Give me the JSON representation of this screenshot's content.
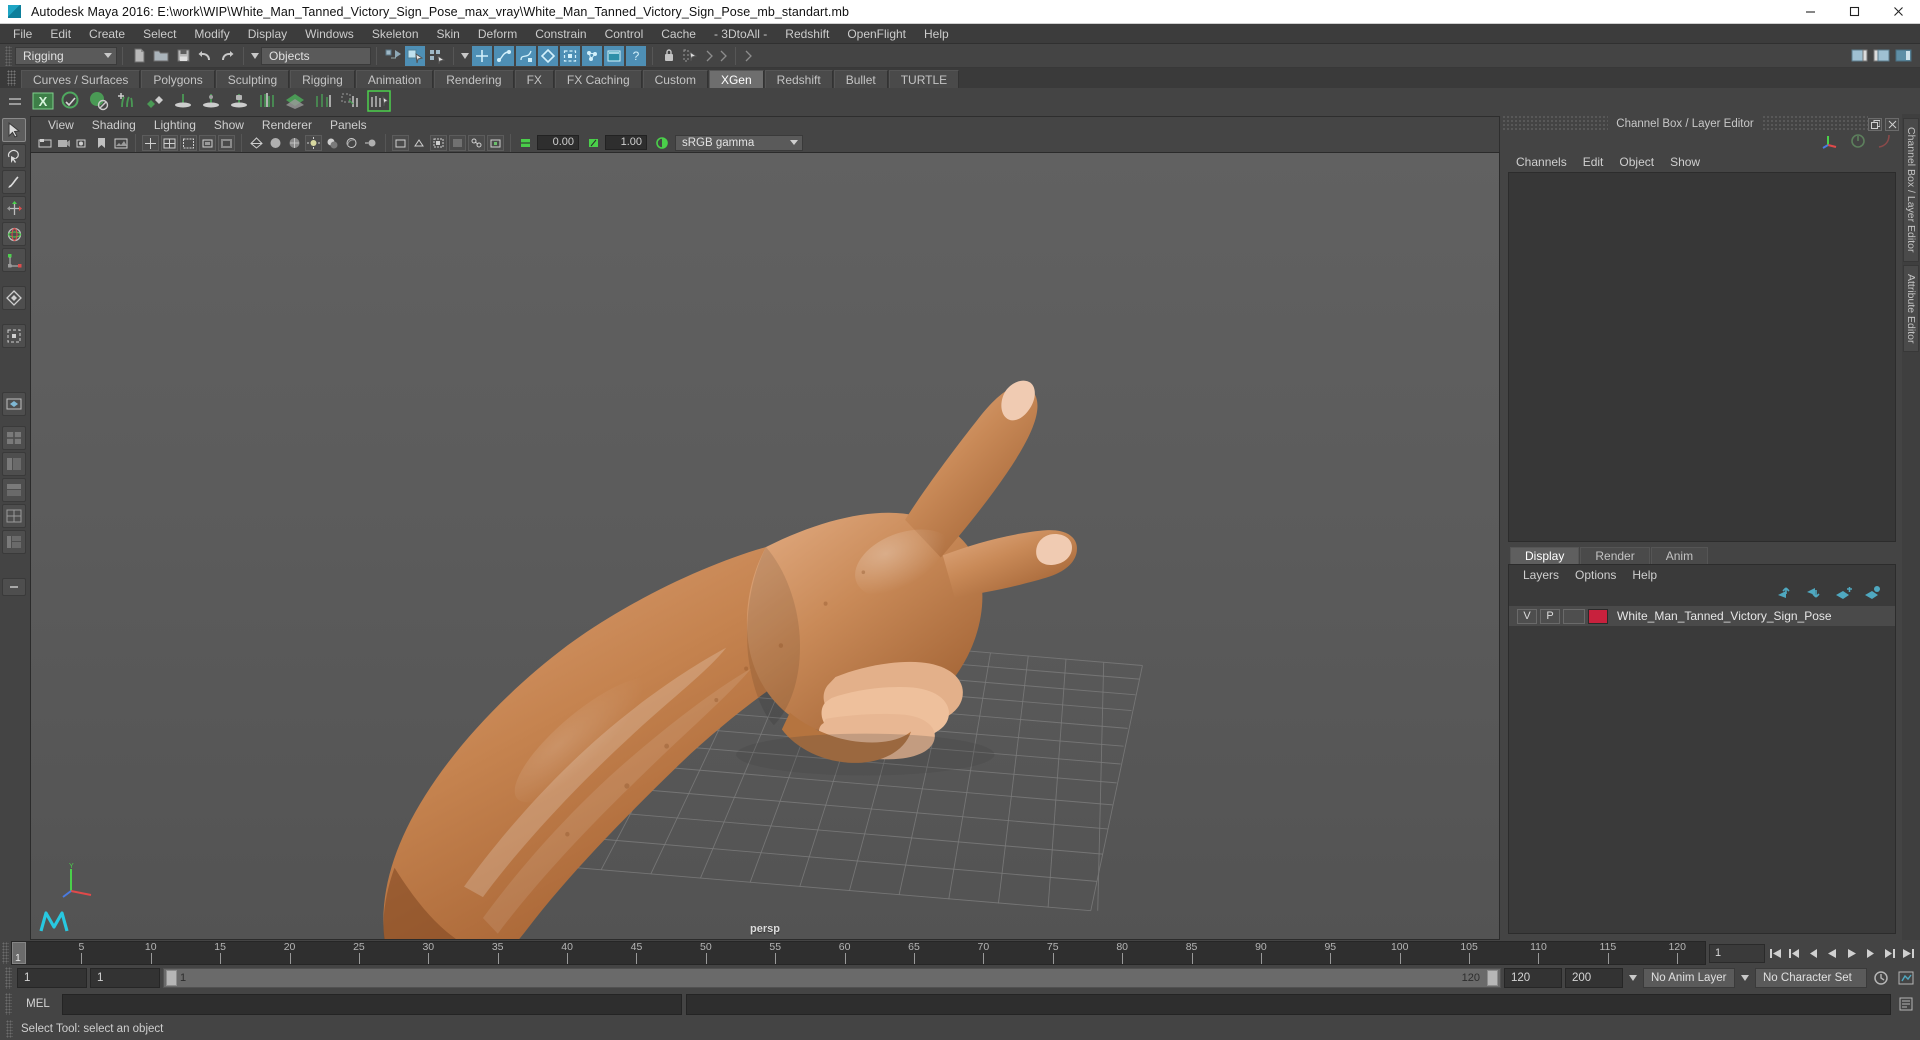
{
  "titlebar": {
    "app_icon": "maya-logo-icon",
    "title": "Autodesk Maya 2016: E:\\work\\WIP\\White_Man_Tanned_Victory_Sign_Pose_max_vray\\White_Man_Tanned_Victory_Sign_Pose_mb_standart.mb",
    "minimize_label": "–",
    "maximize_label": "❐",
    "close_label": "✕"
  },
  "menubar": {
    "items": [
      "File",
      "Edit",
      "Create",
      "Select",
      "Modify",
      "Display",
      "Windows",
      "Skeleton",
      "Skin",
      "Deform",
      "Constrain",
      "Control",
      "Cache",
      "- 3DtoAll -",
      "Redshift",
      "OpenFlight",
      "Help"
    ]
  },
  "statusbar": {
    "mode_menu": "Rigging",
    "selection_mask": "Objects",
    "icons": [
      "new-scene-icon",
      "open-scene-icon",
      "save-scene-icon",
      "undo-icon",
      "redo-icon",
      "select-hierarchy-icon",
      "select-object-icon",
      "select-component-icon",
      "snap-grid-icon",
      "snap-curve-icon",
      "snap-point-icon",
      "snap-view-plane-icon",
      "snap-to-projected-icon",
      "make-live-icon",
      "render-view-icon",
      "help-icon",
      "lock-icon",
      "history-icon",
      "sidebar-toggle-attribute-icon",
      "sidebar-toggle-tool-icon",
      "sidebar-toggle-channel-icon"
    ],
    "right_icons": [
      "show-hide-attribute-editor-icon",
      "show-hide-tool-settings-icon",
      "show-hide-channel-box-icon"
    ]
  },
  "shelf": {
    "tabs": [
      "Curves / Surfaces",
      "Polygons",
      "Sculpting",
      "Rigging",
      "Animation",
      "Rendering",
      "FX",
      "FX Caching",
      "Custom",
      "XGen",
      "Redshift",
      "Bullet",
      "TURTLE"
    ],
    "active_tab": "XGen",
    "icons": [
      "xgen-editor-icon",
      "xgen-sphere-icon",
      "xgen-sphere-filled-icon",
      "xgen-add-guides-icon",
      "xgen-sculpt-guides-icon",
      "xgen-guide-tool-icon",
      "xgen-density-brush-icon",
      "xgen-lock-icon",
      "xgen-comb-icon",
      "xgen-collection-icon",
      "xgen-clump-icon",
      "xgen-noise-icon",
      "xgen-preview-icon"
    ]
  },
  "toolbox": {
    "tools": [
      "select-tool",
      "lasso-select-tool",
      "paint-select-tool",
      "move-tool",
      "rotate-tool",
      "scale-tool",
      "last-tool-used",
      "universal-manipulator",
      "single-perspective-layout",
      "four-view-layout",
      "persp-outliner-layout",
      "persp-graph-editor-layout",
      "hypershade-persp-layout",
      "persp-more-layout",
      "quick-layout-more"
    ]
  },
  "viewport": {
    "menus": [
      "View",
      "Shading",
      "Lighting",
      "Show",
      "Renderer",
      "Panels"
    ],
    "toolbar_icons": [
      "select-camera-icon",
      "lock-camera-icon",
      "camera-attributes-icon",
      "bookmarks-icon",
      "image-plane-icon",
      "two-d-pan-zoom-icon",
      "grid-toggle-icon",
      "film-gate-icon",
      "resolution-gate-icon",
      "gate-mask-icon",
      "field-chart-icon",
      "safe-action-icon",
      "safe-title-icon",
      "wireframe-icon",
      "smooth-shade-all-icon",
      "shade-all-texture-icon",
      "use-all-lights-icon",
      "shadows-icon",
      "ambient-occlusion-icon",
      "motion-blur-icon",
      "multisample-icon",
      "depth-of-field-icon",
      "isolate-select-icon",
      "xray-icon",
      "xray-joints-icon",
      "xray-active-components-icon",
      "exposure-icon",
      "gamma-icon",
      "view-transform-icon"
    ],
    "exposure_value": "0.00",
    "gamma_value": "1.00",
    "view_transform": "sRGB gamma",
    "camera_label": "persp",
    "axis_labels": {
      "y": "Y",
      "x": "X",
      "z": "Z"
    }
  },
  "right_panel": {
    "title": "Channel Box / Layer Editor",
    "float_button": "float-panel-icon",
    "close_button": "close-panel-icon",
    "channel_menus": [
      "Channels",
      "Edit",
      "Object",
      "Show"
    ],
    "cb_icons": [
      "manipulator-icon",
      "channel-speed-icon",
      "channel-curve-icon"
    ],
    "layer_tabs": [
      "Display",
      "Render",
      "Anim"
    ],
    "layer_active_tab": "Display",
    "layer_menus": [
      "Layers",
      "Options",
      "Help"
    ],
    "layer_buttons": [
      "move-layer-up-icon",
      "move-layer-down-icon",
      "create-new-layer-icon",
      "create-layer-from-selected-icon"
    ],
    "layers": [
      {
        "visibility": "V",
        "playback": "P",
        "display_type": "",
        "color": "#c8213d",
        "name": "White_Man_Tanned_Victory_Sign_Pose"
      }
    ],
    "side_tabs": [
      "Channel Box / Layer Editor",
      "Attribute Editor"
    ]
  },
  "timeline": {
    "current_frame": "1",
    "ticks": [
      5,
      10,
      15,
      20,
      25,
      30,
      35,
      40,
      45,
      50,
      55,
      60,
      65,
      70,
      75,
      80,
      85,
      90,
      95,
      100,
      105,
      110,
      115,
      120
    ],
    "frame_field": "1",
    "playback_icons": [
      "go-to-start-icon",
      "step-back-key-icon",
      "step-back-frame-icon",
      "play-backwards-icon",
      "play-forwards-icon",
      "step-forward-frame-icon",
      "step-forward-key-icon",
      "go-to-end-icon"
    ]
  },
  "rangebar": {
    "anim_start": "1",
    "range_start": "1",
    "range_slider_start": "1",
    "range_slider_end": "120",
    "range_end": "120",
    "anim_end": "200",
    "anim_layer": "No Anim Layer",
    "character_set": "No Character Set",
    "auto_key_icon": "auto-keyframe-icon",
    "prefs_icon": "animation-preferences-icon"
  },
  "command_line": {
    "language_label": "MEL",
    "input_value": "",
    "output_value": "",
    "script_editor_icon": "script-editor-icon"
  },
  "statusline": {
    "message": "Select Tool: select an object"
  },
  "colors": {
    "accent_blue": "#4e8fb5",
    "shelf_green": "#4a9a55",
    "layer_red": "#c8213d",
    "panel_bg": "#444444",
    "viewport_bg": "#5c5c5c"
  }
}
